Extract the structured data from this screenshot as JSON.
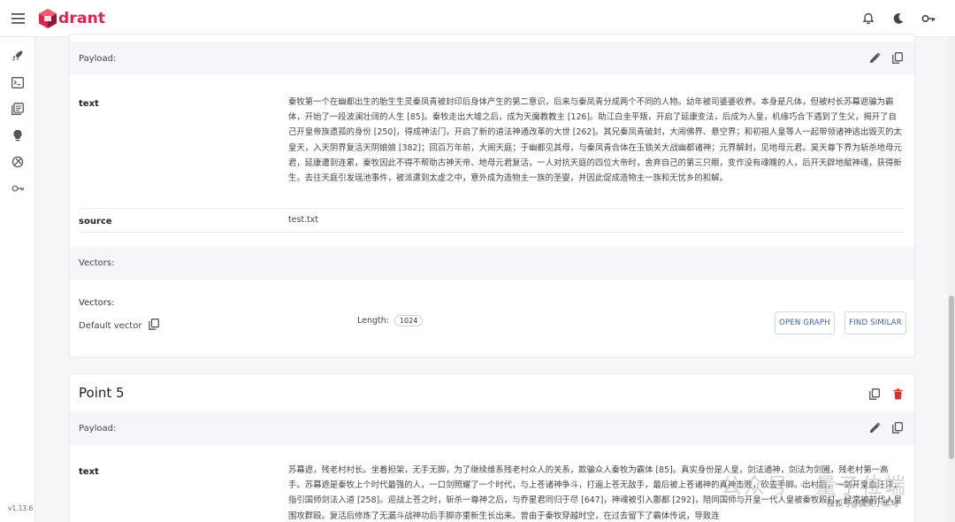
{
  "app": {
    "logo_text": "drant",
    "version": "v1.13.6",
    "brand_color": "#dc244c"
  },
  "icons": {
    "topbar": [
      "menu-icon",
      "bell-icon",
      "moon-icon",
      "key-icon"
    ],
    "sidebar": [
      "rocket-icon",
      "terminal-icon",
      "collections-icon",
      "bulb-icon",
      "plugin-icon",
      "key-icon"
    ]
  },
  "point_a": {
    "payload_label": "Payload:",
    "fields": [
      {
        "key": "text",
        "value": "秦牧第一个在幽都出生的胎生生灵秦凤青被封印后身体产生的第二意识，后来与秦凤青分成两个不同的人物。幼年被司婆婆收养。本身是凡体，但被村长苏幕遮骗为霸体，开始了一段波澜壮阔的人生 [85]。秦牧走出大墟之后，成为天魔教教主 [126]。助江白圭平叛，开启了延康变法，后成为人皇，机缘巧合下遇到了生父，揭开了自己开皇帝族遗孤的身份 [250]，得成神法门，开启了新的道法神通改革的大世 [262]。其兄秦凤青破封，大闹佛界、悬空界；和初祖人皇等人一起带领诸神逃出毁灭的太皇天，入天阴界复活天阴娘娘 [382]；回百万年前，大闹天庭；于幽都见其母，与秦凤青合体在玉锁关大战幽都诸神；元界解封，见地母元君。昊天尊下界为斩杀地母元君，延康遭到连累，秦牧因此不得不帮助古神天帝、地母元君复活，一人对抗天庭的四位大帝时，舍弃自己的第三只眼，变作没有魂魄的人，后开天辟地赋神魂，获得新生。去往天庭引发瑶池事件，被派遣到太虚之中，意外成为造物主一族的圣婴，并因此促成造物主一族和无忧乡的和解。"
      },
      {
        "key": "source",
        "value": "test.txt"
      }
    ],
    "vectors_label": "Vectors:",
    "vectors_title": "Vectors:",
    "vector_name": "Default vector",
    "length_label": "Length:",
    "length_value": "1024",
    "open_graph_label": "OPEN GRAPH",
    "find_similar_label": "FIND SIMILAR"
  },
  "point_b": {
    "title": "Point 5",
    "payload_label": "Payload:",
    "fields": [
      {
        "key": "text",
        "value": "苏幕遮，残老村村长。坐着担架，无手无脚，为了继续维系残老村众人的关系，欺骗众人秦牧为霸体 [85]。真实身份是人皇，剑法通神，剑法为剑圃，残老村第一高手。苏幕遮是秦牧上个时代最强的人，一口剑照耀了一个时代，与上苍诸神争斗，打遍上苍无敌手，最后被上苍诸神的真神击败，砍去手脚。出村后，一剑开皇血汪洋，指引国师剑法入道 [258]。迎战上苍之时，斩杀一尊神之后，与乔星君同归于尽 [647]，神魂被引入鄷都 [292]，陪同国师与开皇一代人皇被秦牧殴打，经常被前代人皇围攻群殴。复活后修炼了无漏斗战神功后手脚亦重新生长出来。曾由于秦牧穿越时空，在过去留下了霸体传说，导致连"
      }
    ]
  },
  "watermark": {
    "big_text": "公众号 · 量子位端",
    "small_text": "搜狐号@搞笑小黑马"
  }
}
